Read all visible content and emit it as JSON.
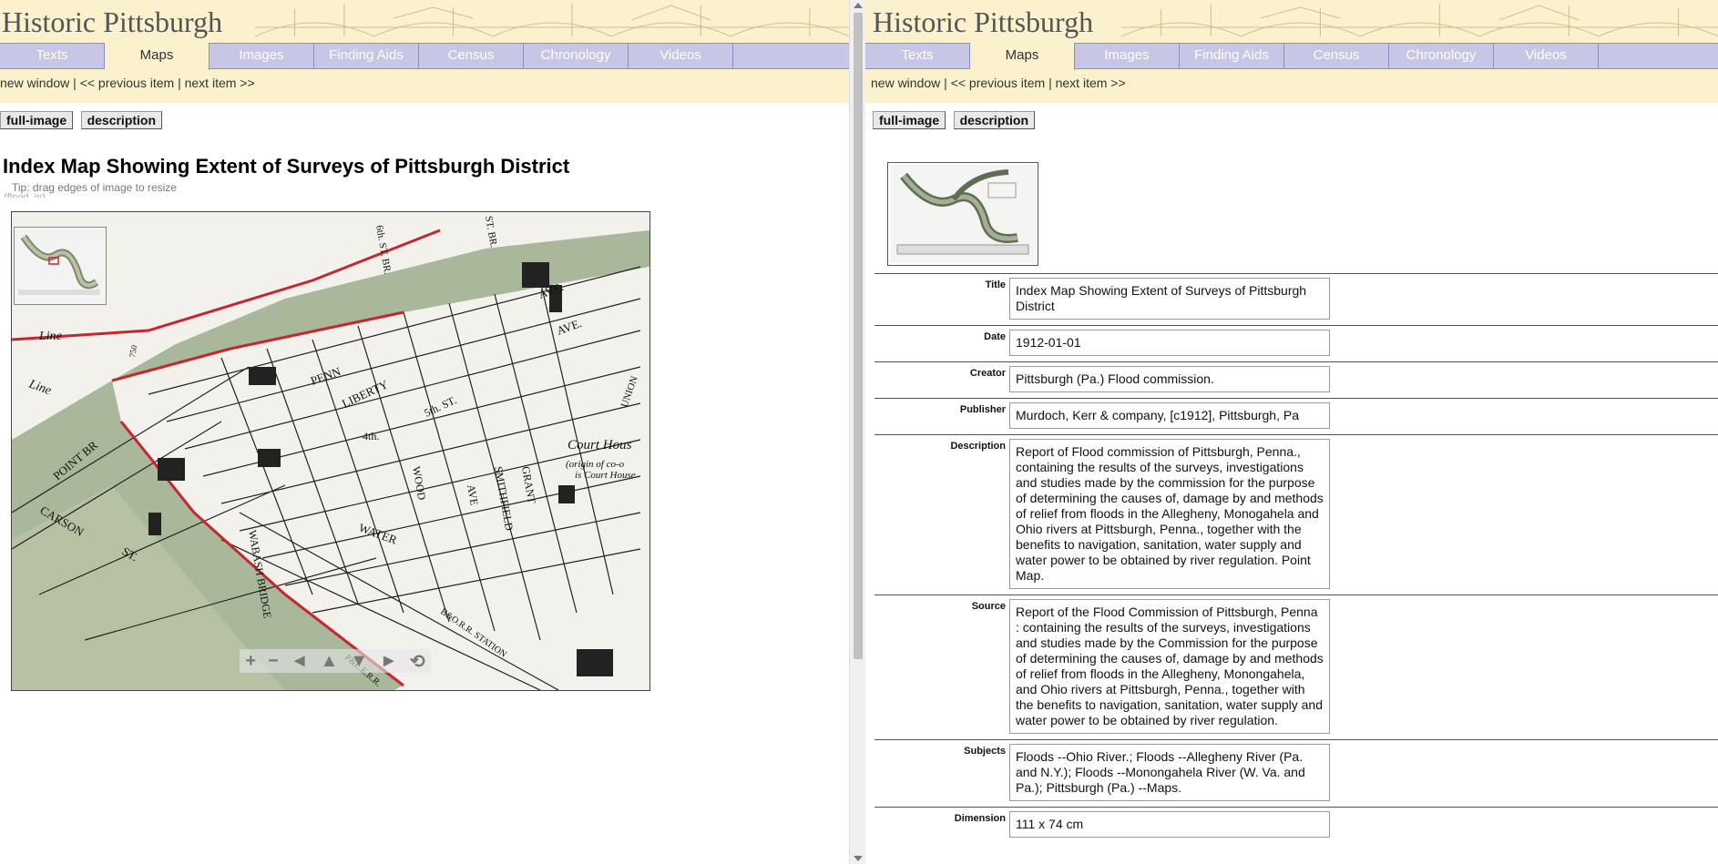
{
  "site_title": "Historic Pittsburgh",
  "nav_tabs": [
    "Texts",
    "Maps",
    "Images",
    "Finding Aids",
    "Census",
    "Chronology",
    "Videos"
  ],
  "active_tab": "Maps",
  "left": {
    "links": {
      "new_window": "new window",
      "sep1": " | ",
      "prev": "<< previous item",
      "sep2": " | ",
      "next": "next item >>"
    },
    "buttons": {
      "full_image": "full-image",
      "description": "description"
    },
    "item_title": "Index Map Showing Extent of Surveys of Pittsburgh District",
    "tip": "Tip: drag edges of image to resize",
    "tip2": "(flood_in)",
    "map_labels": {
      "line1": "Line",
      "line2": "Line",
      "point_br": "POINT BR",
      "carson": "CARSON",
      "st": "ST.",
      "wabash": "WABASH BRIDGE",
      "water": "WATER",
      "penn": "PENN",
      "liberty": "LIBERTY",
      "fifth": "5th. ST.",
      "fourth": "4th.",
      "wood": "WOOD",
      "ave": "AVE",
      "smithfield": "SMITHFIELD",
      "grant": "GRANT",
      "court_house": "Court Hous",
      "origin1": "(origin of co-o",
      "origin2": "is Court House",
      "union": "UNION",
      "sixth": "6th. ST. BR.",
      "stbr": "ST. BR.",
      "lave1": "AVE.",
      "lave2": "AVE.",
      "b_o": "B&O.R.R. STATION",
      "plerr": "P&L.E.R.R.",
      "elev": "750"
    },
    "map_controls": [
      "+",
      "−",
      "◄",
      "▲",
      "▼",
      "►",
      "⟲"
    ]
  },
  "right": {
    "links": {
      "new_window": "new window",
      "sep1": " | ",
      "prev": "<< previous item",
      "sep2": " | ",
      "next": "next item >>"
    },
    "buttons": {
      "full_image": "full-image",
      "description": "description"
    },
    "metadata": [
      {
        "label": "Title",
        "value": "Index Map Showing Extent of Surveys of Pittsburgh District"
      },
      {
        "label": "Date",
        "value": "1912-01-01"
      },
      {
        "label": "Creator",
        "value": "Pittsburgh (Pa.) Flood commission."
      },
      {
        "label": "Publisher",
        "value": "Murdoch, Kerr & company, [c1912], Pittsburgh, Pa"
      },
      {
        "label": "Description",
        "value": "Report of Flood commission of Pittsburgh, Penna., containing the results of the surveys, investigations and studies made by the commission for the purpose of determining the causes of, damage by and methods of relief from floods in the Allegheny, Monogahela and Ohio rivers at Pittsburgh, Penna., together with the benefits to navigation, sanitation, water supply and water power to be obtained by river regulation. Point Map."
      },
      {
        "label": "Source",
        "value": "Report of the Flood Commission of Pittsburgh, Penna : containing the results of the surveys, investigations and studies made by the Commission for the purpose of determining the causes of, damage by and methods of relief from floods in the Allegheny, Monongahela, and Ohio rivers at Pittsburgh, Penna., together with the benefits to navigation, sanitation, water supply and water power to be obtained by river regulation."
      },
      {
        "label": "Subjects",
        "value": "Floods --Ohio River.; Floods --Allegheny River (Pa. and N.Y.); Floods --Monongahela River (W. Va. and Pa.); Pittsburgh (Pa.) --Maps."
      },
      {
        "label": "Dimension",
        "value": "111 x 74 cm"
      }
    ]
  },
  "colors": {
    "banner": "#fbf1cc",
    "nav": "#c7c6e6",
    "nav_border": "#8e8cc0",
    "river": "#a9b79a",
    "map_paper": "#f2f1ec"
  }
}
